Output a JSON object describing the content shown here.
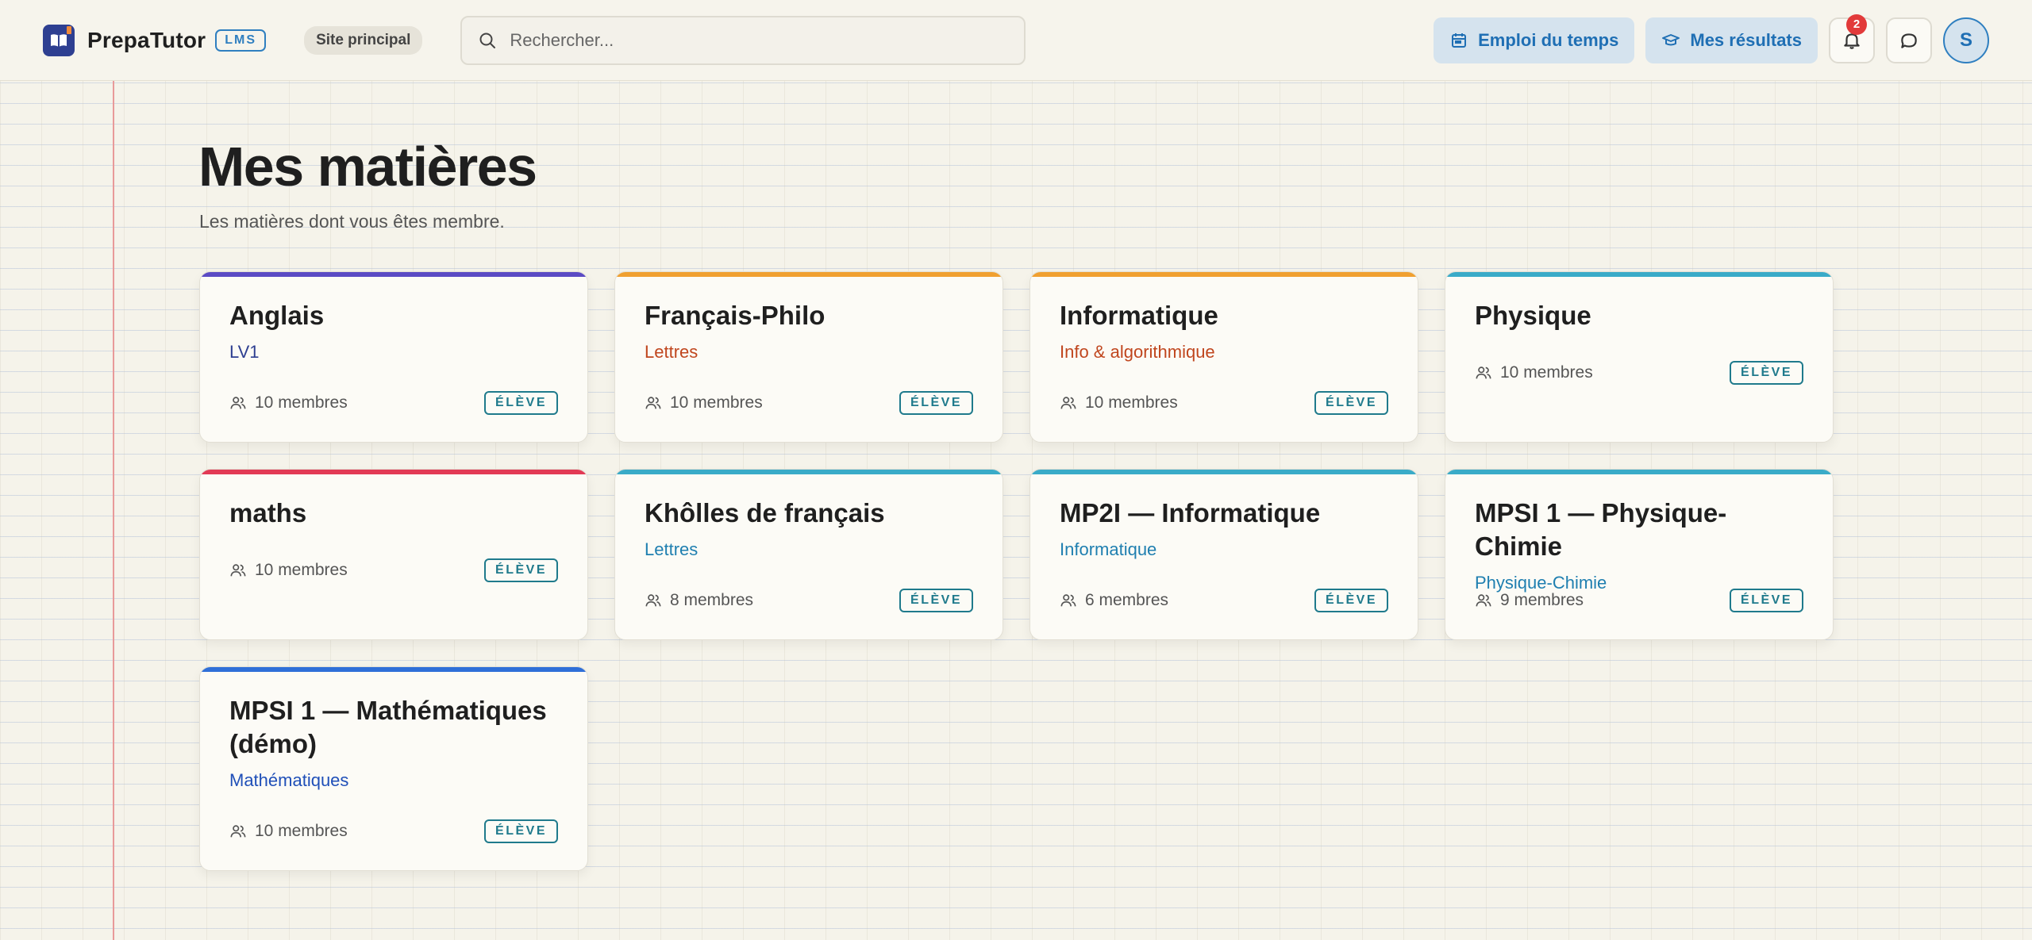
{
  "header": {
    "brand": "PrepaTutor",
    "lms_badge": "LMS",
    "site_chip": "Site principal",
    "search_placeholder": "Rechercher...",
    "schedule_label": "Emploi du temps",
    "results_label": "Mes résultats",
    "notification_count": "2",
    "avatar_initial": "S"
  },
  "page": {
    "title": "Mes matières",
    "subtitle": "Les matières dont vous êtes membre."
  },
  "courses": [
    {
      "name": "Anglais",
      "category": "LV1",
      "members": "10 membres",
      "role": "ÉLÈVE",
      "accent": "#5b4bc4",
      "category_color": "#2e3f91"
    },
    {
      "name": "Français-Philo",
      "category": "Lettres",
      "members": "10 membres",
      "role": "ÉLÈVE",
      "accent": "#f0a030",
      "category_color": "#c0461e"
    },
    {
      "name": "Informatique",
      "category": "Info & algorithmique",
      "members": "10 membres",
      "role": "ÉLÈVE",
      "accent": "#f0a030",
      "category_color": "#c0461e"
    },
    {
      "name": "Physique",
      "category": "",
      "members": "10 membres",
      "role": "ÉLÈVE",
      "accent": "#3aabc8",
      "category_color": "#1f7a8c"
    },
    {
      "name": "maths",
      "category": "",
      "members": "10 membres",
      "role": "ÉLÈVE",
      "accent": "#e23a55",
      "category_color": "#1f7a8c"
    },
    {
      "name": "Khôlles de français",
      "category": "Lettres",
      "members": "8 membres",
      "role": "ÉLÈVE",
      "accent": "#3aabc8",
      "category_color": "#1f7fb0"
    },
    {
      "name": "MP2I — Informatique",
      "category": "Informatique",
      "members": "6 membres",
      "role": "ÉLÈVE",
      "accent": "#3aabc8",
      "category_color": "#1f7fb0"
    },
    {
      "name": "MPSI 1 — Physique-Chimie",
      "category": "Physique-Chimie",
      "members": "9 membres",
      "role": "ÉLÈVE",
      "accent": "#3aabc8",
      "category_color": "#1f7fb0"
    },
    {
      "name": "MPSI 1 — Mathématiques (démo)",
      "category": "Mathématiques",
      "members": "10 membres",
      "role": "ÉLÈVE",
      "accent": "#2f6fd8",
      "category_color": "#1f4fb8"
    }
  ]
}
